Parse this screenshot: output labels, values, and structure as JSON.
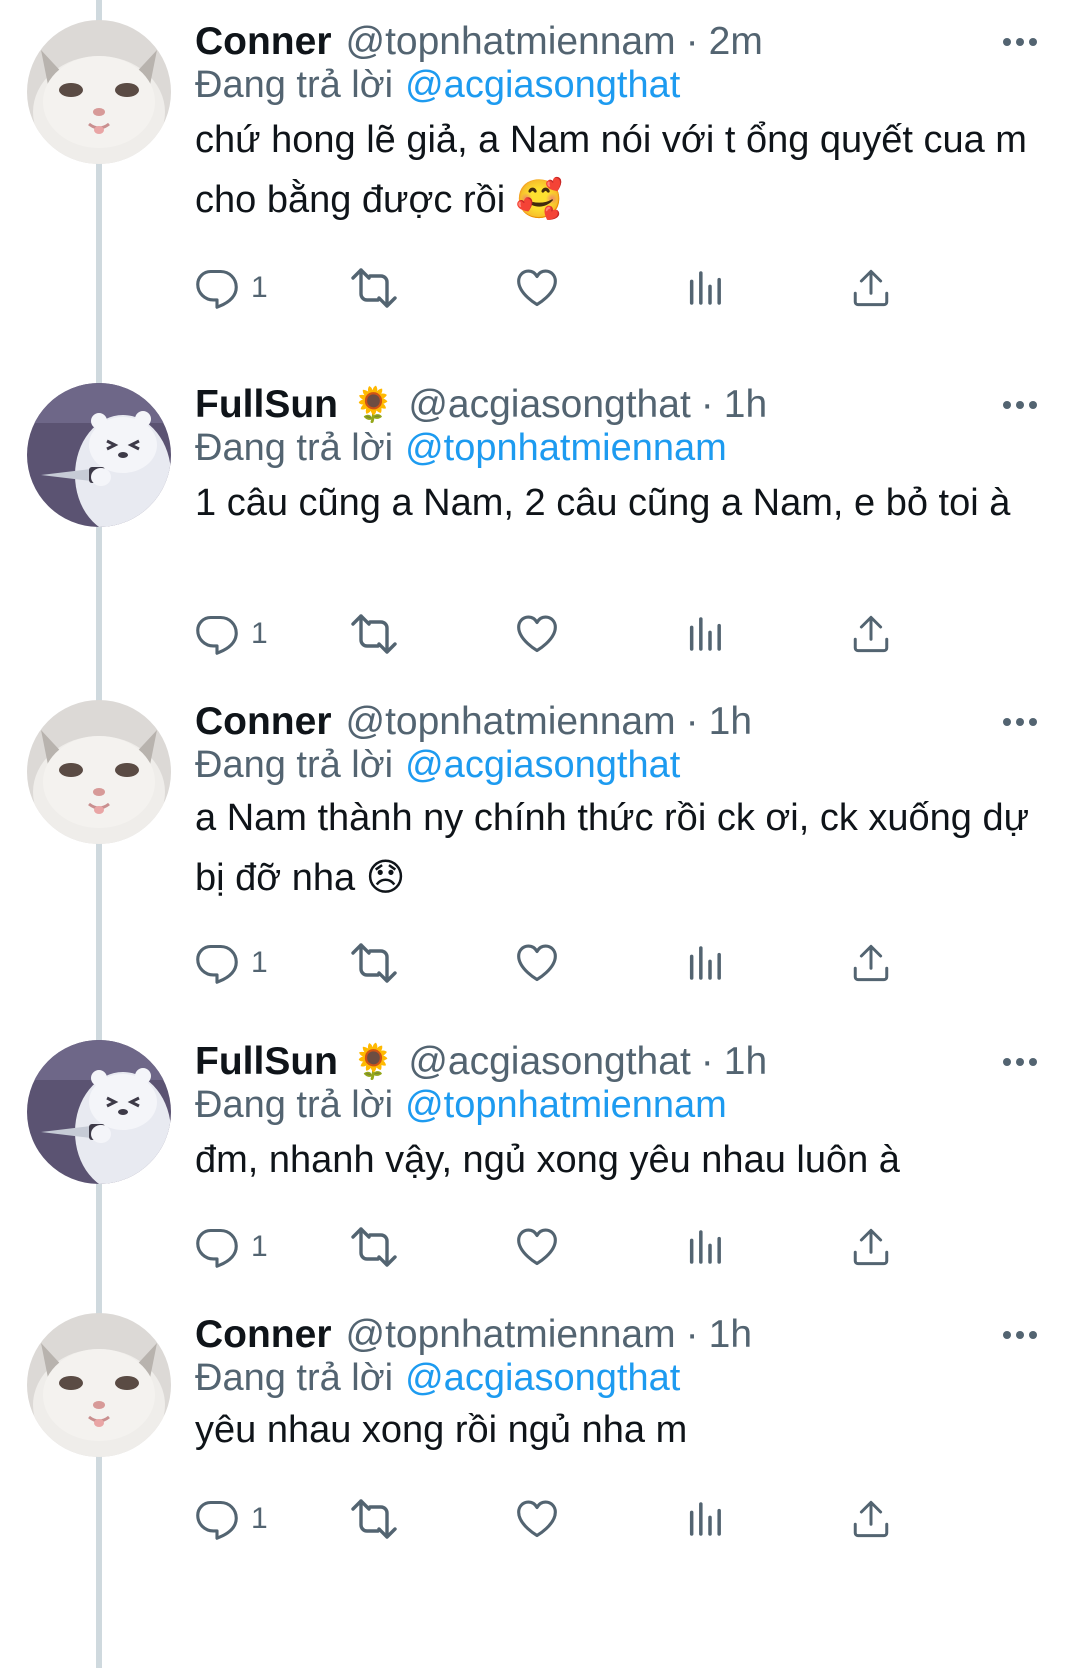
{
  "reply_prefix": "Đang trả lời",
  "tweets": [
    {
      "name": "Conner",
      "badge": "",
      "handle": "@topnhatmiennam",
      "dot": "·",
      "time": "2m",
      "reply_to": "@acgiasongthat",
      "text": "chứ hong lẽ giả, a Nam nói với t ổng quyết cua m cho bằng được rồi 🥰",
      "reply_count": "1",
      "avatar": "white-cat-avatar"
    },
    {
      "name": "FullSun",
      "badge": "🌻",
      "handle": "@acgiasongthat",
      "dot": "·",
      "time": "1h",
      "reply_to": "@topnhatmiennam",
      "text": "1 câu cũng a Nam, 2 câu cũng a Nam, e bỏ toi à",
      "reply_count": "1",
      "avatar": "polar-bear-knife-avatar"
    },
    {
      "name": "Conner",
      "badge": "",
      "handle": "@topnhatmiennam",
      "dot": "·",
      "time": "1h",
      "reply_to": "@acgiasongthat",
      "text": "a Nam thành ny chính thức rồi ck ơi, ck xuống dự bị đỡ nha 😞",
      "reply_count": "1",
      "avatar": "white-cat-avatar"
    },
    {
      "name": "FullSun",
      "badge": "🌻",
      "handle": "@acgiasongthat",
      "dot": "·",
      "time": "1h",
      "reply_to": "@topnhatmiennam",
      "text": "đm, nhanh vậy, ngủ xong yêu nhau luôn à",
      "reply_count": "1",
      "avatar": "polar-bear-knife-avatar"
    },
    {
      "name": "Conner",
      "badge": "",
      "handle": "@topnhatmiennam",
      "dot": "·",
      "time": "1h",
      "reply_to": "@acgiasongthat",
      "text": "yêu nhau xong rồi ngủ nha m",
      "reply_count": "1",
      "avatar": "white-cat-avatar"
    }
  ],
  "colors": {
    "link": "#1d9bf0",
    "secondary_text": "#536471",
    "thread_line": "#cfd9de"
  }
}
